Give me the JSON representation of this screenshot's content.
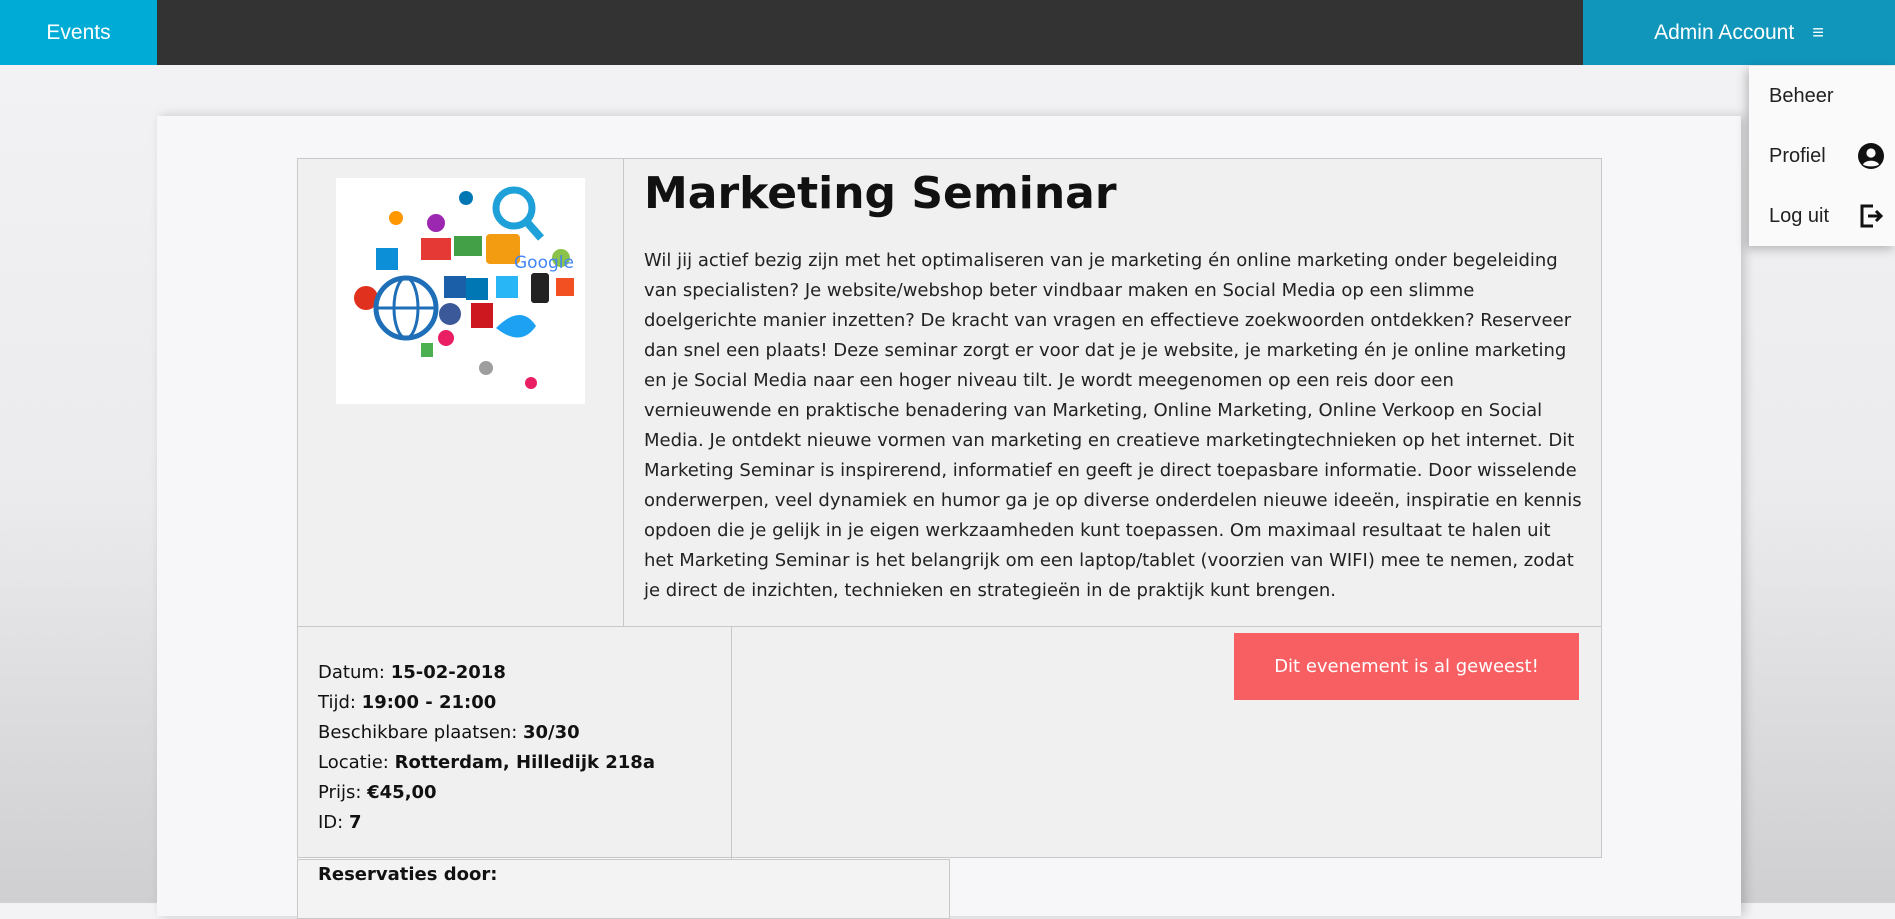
{
  "nav": {
    "brand": "Events",
    "account_label": "Admin Account",
    "menu_icon": "≡"
  },
  "dropdown": {
    "items": [
      {
        "label": "Beheer",
        "icon": ""
      },
      {
        "label": "Profiel",
        "icon": "user-circle-icon"
      },
      {
        "label": "Log uit",
        "icon": "logout-icon"
      }
    ]
  },
  "event": {
    "title": "Marketing Seminar",
    "image_alt": "marketing social media icons cloud",
    "description": "Wil jij actief bezig zijn met het optimaliseren van je marketing én online marketing onder begeleiding van specialisten? Je website/webshop beter vindbaar maken en Social Media op een slimme doelgerichte manier inzetten? De kracht van vragen en effectieve zoekwoorden ontdekken? Reserveer dan snel een plaats! Deze seminar zorgt er voor dat je je website, je marketing én je online marketing en je Social Media naar een hoger niveau tilt. Je wordt meegenomen op een reis door een vernieuwende en praktische benadering van Marketing, Online Marketing, Online Verkoop en Social Media. Je ontdekt nieuwe vormen van marketing en creatieve marketingtechnieken op het internet. Dit Marketing Seminar is inspirerend, informatief en geeft je direct toepasbare informatie. Door wisselende onderwerpen, veel dynamiek en humor ga je op diverse onderdelen nieuwe ideeën, inspiratie en kennis opdoen die je gelijk in je eigen werkzaamheden kunt toepassen. Om maximaal resultaat te halen uit het Marketing Seminar is het belangrijk om een laptop/tablet (voorzien van WIFI) mee te nemen, zodat je direct de inzichten, technieken en strategieën in de praktijk kunt brengen.",
    "details": {
      "date_label": "Datum:",
      "date": "15-02-2018",
      "time_label": "Tijd:",
      "time": "19:00 - 21:00",
      "seats_label": "Beschikbare plaatsen:",
      "seats": "30/30",
      "location_label": "Locatie:",
      "location": "Rotterdam, Hilledijk 218a",
      "price_label": "Prijs:",
      "price": "€45,00",
      "id_label": "ID:",
      "id": "7"
    },
    "status_button": "Dit evenement is al geweest!",
    "reservations_label": "Reservaties door:"
  },
  "colors": {
    "brand": "#00acd6",
    "account": "#1096bb",
    "topbar": "#333333",
    "past_button": "#f85f63"
  }
}
